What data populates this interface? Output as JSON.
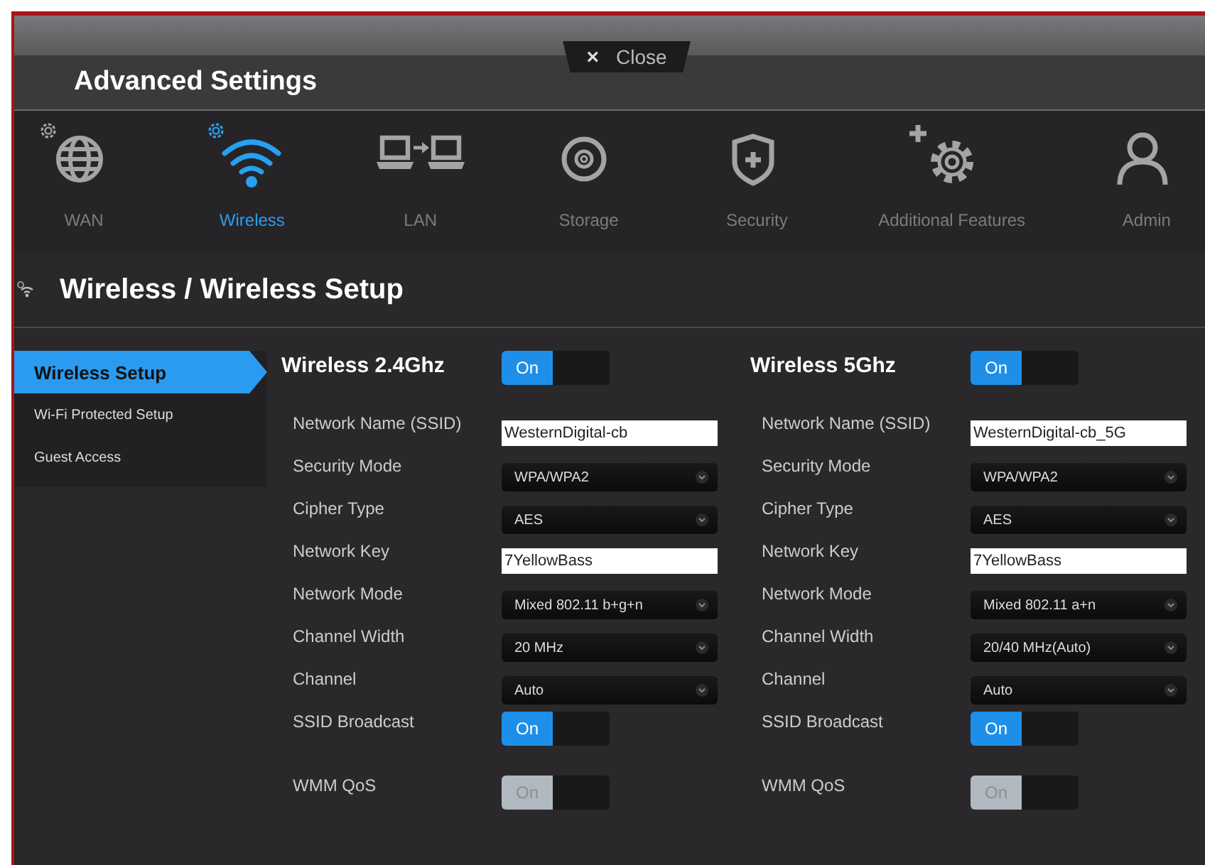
{
  "window": {
    "title": "Advanced Settings",
    "close": {
      "icon": "×",
      "label": "Close"
    }
  },
  "nav": [
    {
      "kind": "globe",
      "label": "WAN",
      "selected": false
    },
    {
      "kind": "wifi",
      "label": "Wireless",
      "selected": true
    },
    {
      "kind": "lan",
      "label": "LAN",
      "selected": false
    },
    {
      "kind": "disc",
      "label": "Storage",
      "selected": false
    },
    {
      "kind": "shield",
      "label": "Security",
      "selected": false
    },
    {
      "kind": "gear-plus",
      "label": "Additional Features",
      "selected": false
    },
    {
      "kind": "person",
      "label": "Admin",
      "selected": false
    }
  ],
  "breadcrumb": "Wireless / Wireless Setup",
  "sidebar": {
    "items": [
      {
        "label": "Wireless Setup",
        "selected": true
      },
      {
        "label": "Wi-Fi Protected Setup",
        "selected": false
      },
      {
        "label": "Guest Access",
        "selected": false
      }
    ]
  },
  "bands": [
    {
      "title": "Wireless 2.4Ghz",
      "toggle": {
        "label": "On",
        "on": true,
        "disabled": false
      },
      "fields": [
        {
          "kind": "text",
          "label": "Network Name (SSID)",
          "value": "WesternDigital-cb"
        },
        {
          "kind": "select",
          "label": "Security Mode",
          "value": "WPA/WPA2"
        },
        {
          "kind": "select",
          "label": "Cipher Type",
          "value": "AES"
        },
        {
          "kind": "text",
          "label": "Network Key",
          "value": "7YellowBass"
        },
        {
          "kind": "select",
          "label": "Network Mode",
          "value": "Mixed 802.11 b+g+n"
        },
        {
          "kind": "select",
          "label": "Channel Width",
          "value": "20 MHz"
        },
        {
          "kind": "select",
          "label": "Channel",
          "value": "Auto"
        },
        {
          "kind": "toggle",
          "label": "SSID Broadcast",
          "toggle": {
            "label": "On",
            "on": true,
            "disabled": false
          }
        },
        {
          "kind": "toggle",
          "label": "WMM QoS",
          "toggle": {
            "label": "On",
            "on": true,
            "disabled": true
          }
        }
      ]
    },
    {
      "title": "Wireless 5Ghz",
      "toggle": {
        "label": "On",
        "on": true,
        "disabled": false
      },
      "fields": [
        {
          "kind": "text",
          "label": "Network Name (SSID)",
          "value": "WesternDigital-cb_5G"
        },
        {
          "kind": "select",
          "label": "Security Mode",
          "value": "WPA/WPA2"
        },
        {
          "kind": "select",
          "label": "Cipher Type",
          "value": "AES"
        },
        {
          "kind": "text",
          "label": "Network Key",
          "value": "7YellowBass"
        },
        {
          "kind": "select",
          "label": "Network Mode",
          "value": "Mixed 802.11 a+n"
        },
        {
          "kind": "select",
          "label": "Channel Width",
          "value": "20/40 MHz(Auto)"
        },
        {
          "kind": "select",
          "label": "Channel",
          "value": "Auto"
        },
        {
          "kind": "toggle",
          "label": "SSID Broadcast",
          "toggle": {
            "label": "On",
            "on": true,
            "disabled": false
          }
        },
        {
          "kind": "toggle",
          "label": "WMM QoS",
          "toggle": {
            "label": "On",
            "on": true,
            "disabled": true
          }
        }
      ]
    }
  ]
}
